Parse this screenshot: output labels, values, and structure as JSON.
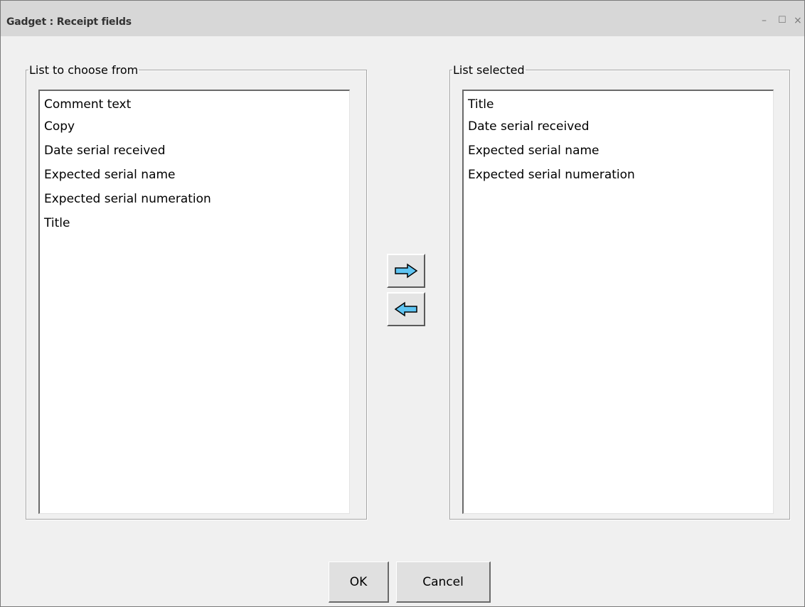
{
  "window": {
    "title": "Gadget : Receipt fields",
    "controls": {
      "minimize": "–",
      "maximize": "☐",
      "close": "×"
    }
  },
  "available": {
    "legend": "List to choose from",
    "items": [
      "Comment text",
      "Copy",
      "Date serial received",
      "Expected serial name",
      "Expected serial numeration",
      "Title"
    ]
  },
  "selected": {
    "legend": "List selected",
    "items": [
      "Title",
      "Date serial received",
      "Expected serial name",
      "Expected serial numeration"
    ]
  },
  "move_buttons": {
    "add_icon": "arrow-right-icon",
    "remove_icon": "arrow-left-icon",
    "arrow_color": "#5ec4f2"
  },
  "footer": {
    "ok_label": "OK",
    "cancel_label": "Cancel"
  }
}
